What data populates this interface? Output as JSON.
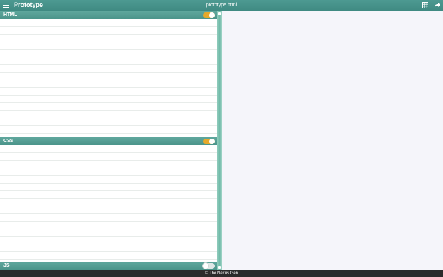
{
  "header": {
    "app_title": "Prototype",
    "file_name": "prototype.html",
    "icons": [
      "menu-icon",
      "grid-icon",
      "share-icon"
    ]
  },
  "sections": {
    "html": {
      "label": "HTML",
      "enabled": true
    },
    "css": {
      "label": "CSS",
      "enabled": true
    },
    "js": {
      "label": "JS",
      "enabled": false
    }
  },
  "footer": {
    "text": "© The Nexus Gen"
  },
  "colors": {
    "header": "#3f8a82",
    "section_header": "#4a9389",
    "toggle_on": "#e6a92b",
    "splitter": "#6db8a6",
    "preview_bg": "#f5f5fa"
  }
}
